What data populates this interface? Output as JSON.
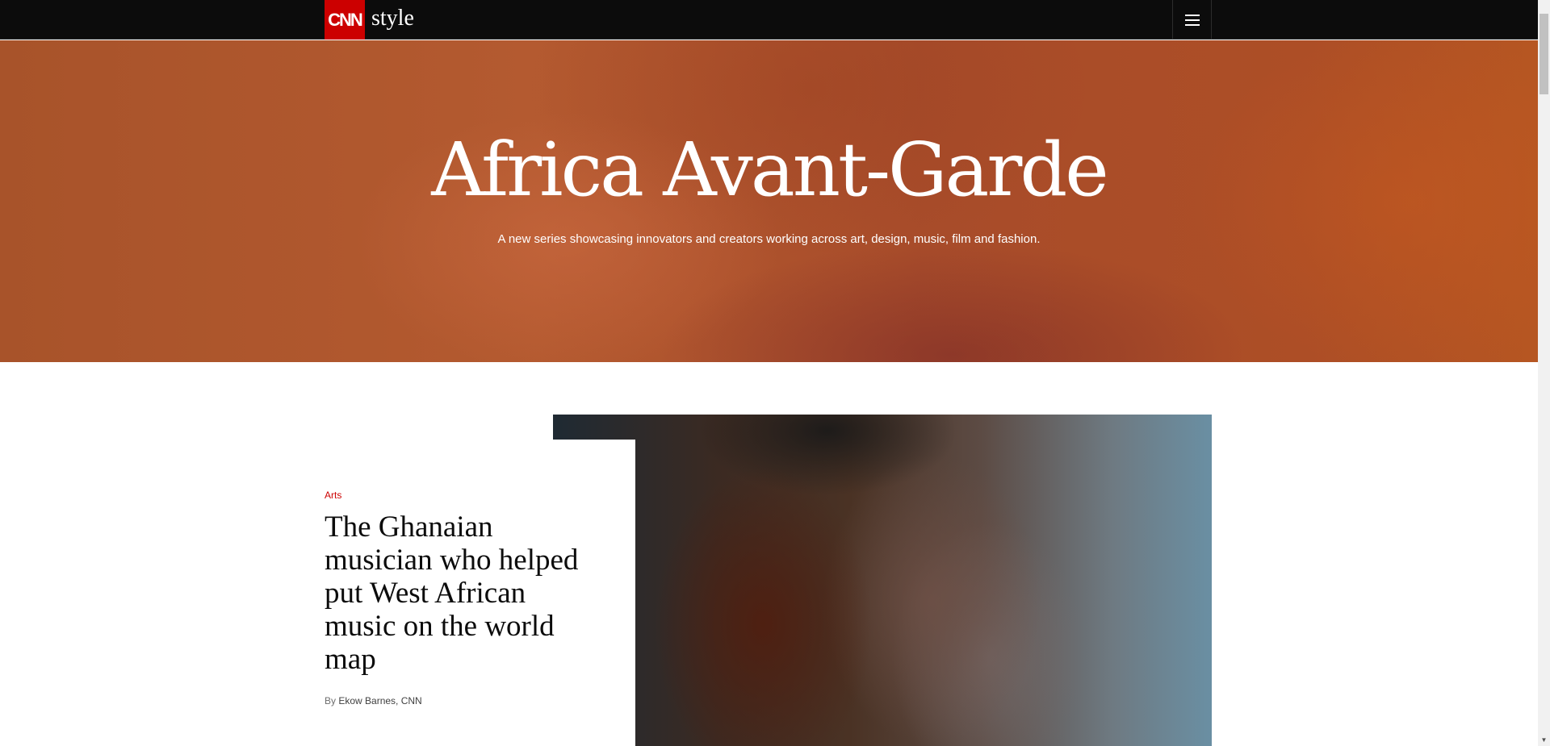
{
  "header": {
    "logo_mark": "CNN",
    "section_name": "style",
    "menu_icon": "hamburger-menu-icon"
  },
  "hero": {
    "title": "Africa Avant-Garde",
    "subtitle": "A new series showcasing innovators and creators working across art, design, music, film and fashion."
  },
  "feature": {
    "kicker": "Arts",
    "headline": "The Ghanaian musician who helped put West African music on the world map",
    "byline_prefix": "By",
    "byline_author": "Ekow Barnes, CNN"
  },
  "colors": {
    "brand_red": "#cc0000",
    "topbar": "#0c0c0c",
    "hero_orange": "#b05a2c"
  }
}
